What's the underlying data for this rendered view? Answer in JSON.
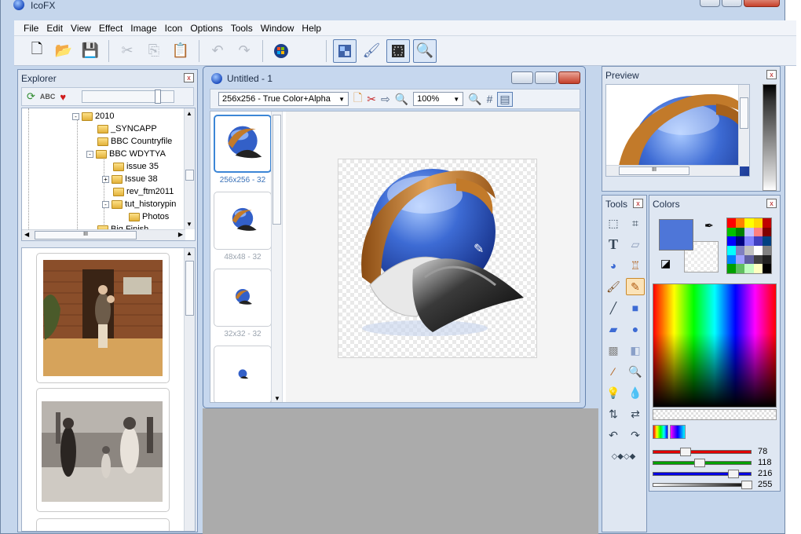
{
  "app": {
    "title": "IcoFX"
  },
  "menu": [
    "File",
    "Edit",
    "View",
    "Effect",
    "Image",
    "Icon",
    "Options",
    "Tools",
    "Window",
    "Help"
  ],
  "toolbar_icons": [
    "new-icon",
    "open-icon",
    "save-icon",
    "cut-icon",
    "copy-icon",
    "paste-icon",
    "undo-icon",
    "redo-icon",
    "windows-icon",
    "apple-icon",
    "image-editor-icon",
    "brush-editor-icon",
    "crop-icon",
    "zoom-icon"
  ],
  "explorer": {
    "title": "Explorer",
    "close": "x",
    "tree": [
      {
        "label": "2010",
        "level": 0,
        "expander": "-"
      },
      {
        "label": "_SYNCAPP",
        "level": 1,
        "expander": ""
      },
      {
        "label": "BBC Countryfile",
        "level": 1,
        "expander": ""
      },
      {
        "label": "BBC WDYTYA",
        "level": 1,
        "expander": "-"
      },
      {
        "label": "issue 35",
        "level": 2,
        "expander": ""
      },
      {
        "label": "Issue 38",
        "level": 2,
        "expander": "+"
      },
      {
        "label": "rev_ftm2011",
        "level": 2,
        "expander": ""
      },
      {
        "label": "tut_historypin",
        "level": 2,
        "expander": "-"
      },
      {
        "label": "Photos",
        "level": 3,
        "expander": ""
      },
      {
        "label": "Big Finish",
        "level": 1,
        "expander": ""
      }
    ],
    "hscroll_label": "III"
  },
  "document": {
    "title": "Untitled - 1",
    "format_select": "256x256 - True Color+Alpha",
    "zoom_select": "100%",
    "formats": [
      {
        "label": "256x256 - 32",
        "selected": true
      },
      {
        "label": "48x48 - 32",
        "selected": false
      },
      {
        "label": "32x32 - 32",
        "selected": false
      },
      {
        "label": "",
        "selected": false
      }
    ]
  },
  "preview": {
    "title": "Preview",
    "hscroll_label": "III"
  },
  "tools": {
    "title": "Tools",
    "items": [
      "select-rect-icon",
      "crop-icon",
      "text-icon",
      "eraser-icon",
      "fill-icon",
      "spray-icon",
      "brush-icon",
      "pencil-icon",
      "line-icon",
      "rectangle-icon",
      "rounded-rect-icon",
      "ellipse-icon",
      "blur-icon",
      "sharpen-icon",
      "color-picker-icon",
      "zoom-icon",
      "burn-icon",
      "dodge-icon",
      "flip-icon",
      "swap-icon",
      "rotate-left-icon",
      "rotate-right-icon",
      "nudge-icon"
    ]
  },
  "colors": {
    "title": "Colors",
    "primary": "#4e76d8",
    "palette": [
      "#ff0000",
      "#ff8000",
      "#ffff00",
      "#ffd700",
      "#c00000",
      "#00c000",
      "#008000",
      "#c0c0ff",
      "#ff8080",
      "#800000",
      "#0000ff",
      "#000080",
      "#8080ff",
      "#4040c0",
      "#004080",
      "#00ffff",
      "#8080c0",
      "#c0c0c0",
      "#ffffff",
      "#808080",
      "#0080ff",
      "#a0a0ff",
      "#6060a0",
      "#404040",
      "#202020",
      "#00a000",
      "#60c060",
      "#c0ffc0",
      "#ffffc0",
      "#000000"
    ],
    "red": 78,
    "green": 118,
    "blue": 216,
    "alpha": 255
  }
}
